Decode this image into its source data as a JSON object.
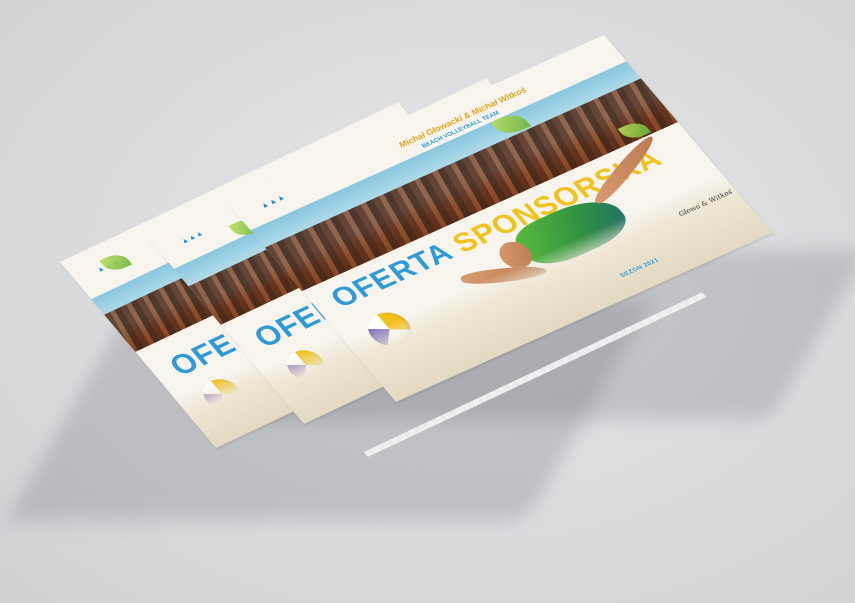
{
  "booklet": {
    "title_part1": "OFERTA",
    "title_part2": "SPONSORSKA",
    "authors": "Michał Głowacki & Michał Witkoś",
    "team": "BEACH VOLLEYBALL TEAM",
    "season": "SEZON 2021",
    "signature": "Głowa & Witkoś",
    "logo_glyph": "▲▲▲"
  },
  "colors": {
    "blue": "#2f9ad8",
    "yellow": "#f2c21b",
    "background": "#dcdddf"
  }
}
